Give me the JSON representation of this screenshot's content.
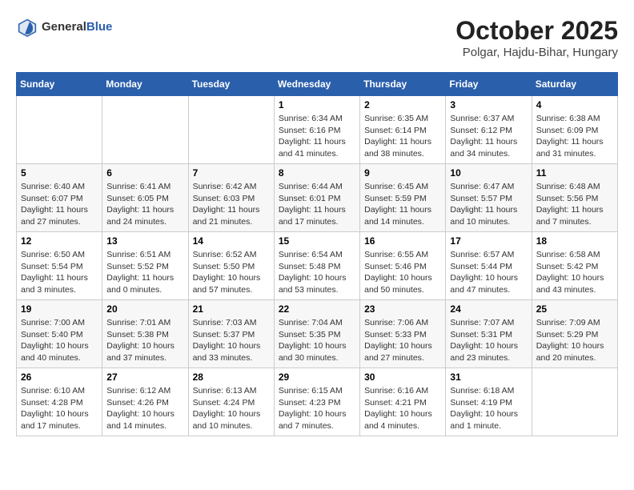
{
  "header": {
    "logo_general": "General",
    "logo_blue": "Blue",
    "month_year": "October 2025",
    "location": "Polgar, Hajdu-Bihar, Hungary"
  },
  "calendar": {
    "days_of_week": [
      "Sunday",
      "Monday",
      "Tuesday",
      "Wednesday",
      "Thursday",
      "Friday",
      "Saturday"
    ],
    "weeks": [
      [
        {
          "day": "",
          "info": ""
        },
        {
          "day": "",
          "info": ""
        },
        {
          "day": "",
          "info": ""
        },
        {
          "day": "1",
          "info": "Sunrise: 6:34 AM\nSunset: 6:16 PM\nDaylight: 11 hours and 41 minutes."
        },
        {
          "day": "2",
          "info": "Sunrise: 6:35 AM\nSunset: 6:14 PM\nDaylight: 11 hours and 38 minutes."
        },
        {
          "day": "3",
          "info": "Sunrise: 6:37 AM\nSunset: 6:12 PM\nDaylight: 11 hours and 34 minutes."
        },
        {
          "day": "4",
          "info": "Sunrise: 6:38 AM\nSunset: 6:09 PM\nDaylight: 11 hours and 31 minutes."
        }
      ],
      [
        {
          "day": "5",
          "info": "Sunrise: 6:40 AM\nSunset: 6:07 PM\nDaylight: 11 hours and 27 minutes."
        },
        {
          "day": "6",
          "info": "Sunrise: 6:41 AM\nSunset: 6:05 PM\nDaylight: 11 hours and 24 minutes."
        },
        {
          "day": "7",
          "info": "Sunrise: 6:42 AM\nSunset: 6:03 PM\nDaylight: 11 hours and 21 minutes."
        },
        {
          "day": "8",
          "info": "Sunrise: 6:44 AM\nSunset: 6:01 PM\nDaylight: 11 hours and 17 minutes."
        },
        {
          "day": "9",
          "info": "Sunrise: 6:45 AM\nSunset: 5:59 PM\nDaylight: 11 hours and 14 minutes."
        },
        {
          "day": "10",
          "info": "Sunrise: 6:47 AM\nSunset: 5:57 PM\nDaylight: 11 hours and 10 minutes."
        },
        {
          "day": "11",
          "info": "Sunrise: 6:48 AM\nSunset: 5:56 PM\nDaylight: 11 hours and 7 minutes."
        }
      ],
      [
        {
          "day": "12",
          "info": "Sunrise: 6:50 AM\nSunset: 5:54 PM\nDaylight: 11 hours and 3 minutes."
        },
        {
          "day": "13",
          "info": "Sunrise: 6:51 AM\nSunset: 5:52 PM\nDaylight: 11 hours and 0 minutes."
        },
        {
          "day": "14",
          "info": "Sunrise: 6:52 AM\nSunset: 5:50 PM\nDaylight: 10 hours and 57 minutes."
        },
        {
          "day": "15",
          "info": "Sunrise: 6:54 AM\nSunset: 5:48 PM\nDaylight: 10 hours and 53 minutes."
        },
        {
          "day": "16",
          "info": "Sunrise: 6:55 AM\nSunset: 5:46 PM\nDaylight: 10 hours and 50 minutes."
        },
        {
          "day": "17",
          "info": "Sunrise: 6:57 AM\nSunset: 5:44 PM\nDaylight: 10 hours and 47 minutes."
        },
        {
          "day": "18",
          "info": "Sunrise: 6:58 AM\nSunset: 5:42 PM\nDaylight: 10 hours and 43 minutes."
        }
      ],
      [
        {
          "day": "19",
          "info": "Sunrise: 7:00 AM\nSunset: 5:40 PM\nDaylight: 10 hours and 40 minutes."
        },
        {
          "day": "20",
          "info": "Sunrise: 7:01 AM\nSunset: 5:38 PM\nDaylight: 10 hours and 37 minutes."
        },
        {
          "day": "21",
          "info": "Sunrise: 7:03 AM\nSunset: 5:37 PM\nDaylight: 10 hours and 33 minutes."
        },
        {
          "day": "22",
          "info": "Sunrise: 7:04 AM\nSunset: 5:35 PM\nDaylight: 10 hours and 30 minutes."
        },
        {
          "day": "23",
          "info": "Sunrise: 7:06 AM\nSunset: 5:33 PM\nDaylight: 10 hours and 27 minutes."
        },
        {
          "day": "24",
          "info": "Sunrise: 7:07 AM\nSunset: 5:31 PM\nDaylight: 10 hours and 23 minutes."
        },
        {
          "day": "25",
          "info": "Sunrise: 7:09 AM\nSunset: 5:29 PM\nDaylight: 10 hours and 20 minutes."
        }
      ],
      [
        {
          "day": "26",
          "info": "Sunrise: 6:10 AM\nSunset: 4:28 PM\nDaylight: 10 hours and 17 minutes."
        },
        {
          "day": "27",
          "info": "Sunrise: 6:12 AM\nSunset: 4:26 PM\nDaylight: 10 hours and 14 minutes."
        },
        {
          "day": "28",
          "info": "Sunrise: 6:13 AM\nSunset: 4:24 PM\nDaylight: 10 hours and 10 minutes."
        },
        {
          "day": "29",
          "info": "Sunrise: 6:15 AM\nSunset: 4:23 PM\nDaylight: 10 hours and 7 minutes."
        },
        {
          "day": "30",
          "info": "Sunrise: 6:16 AM\nSunset: 4:21 PM\nDaylight: 10 hours and 4 minutes."
        },
        {
          "day": "31",
          "info": "Sunrise: 6:18 AM\nSunset: 4:19 PM\nDaylight: 10 hours and 1 minute."
        },
        {
          "day": "",
          "info": ""
        }
      ]
    ]
  }
}
